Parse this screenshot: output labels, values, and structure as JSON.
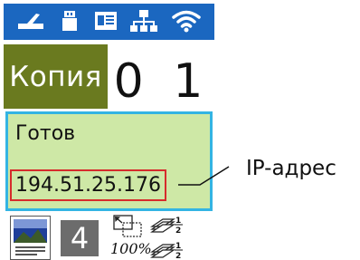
{
  "status_bar": {
    "icons": [
      "scanner-icon",
      "usb-memory-icon",
      "id-card-icon",
      "network-icon",
      "wifi-icon"
    ]
  },
  "mode": {
    "label": "Копия"
  },
  "copies": {
    "value": "0 1"
  },
  "status_panel": {
    "state": "Готов",
    "ip_address": "194.51.25.176"
  },
  "bottom_bar": {
    "density": "4",
    "zoom": "100%",
    "page_layout_icons": [
      "one-sided-to-two-sided-icon",
      "two-sided-to-two-sided-icon"
    ]
  },
  "callout": {
    "label": "IP-адрес"
  },
  "colors": {
    "status_bar": "#1b67c0",
    "mode_box": "#6a7a1f",
    "status_panel": "#cee8a6",
    "status_panel_border": "#33b4e3",
    "ip_highlight": "#d62c2c",
    "density_box": "#6c6c6c"
  }
}
